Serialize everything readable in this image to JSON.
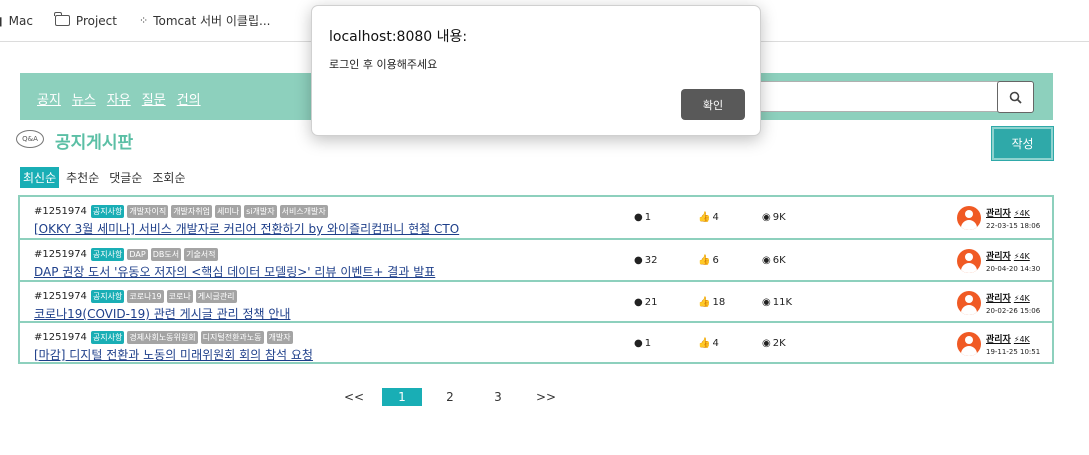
{
  "bookmarks": [
    {
      "label": "Mac",
      "icon": "apple-icon"
    },
    {
      "label": "Project",
      "icon": "folder-icon"
    },
    {
      "label": "Tomcat 서버 이클립...",
      "icon": "dots-icon"
    }
  ],
  "nav": {
    "links": [
      "공지",
      "뉴스",
      "자유",
      "질문",
      "건의"
    ],
    "search_icon": "search-icon"
  },
  "board": {
    "icon_text": "Q&A",
    "title": "공지게시판",
    "write_label": "작성"
  },
  "sort_tabs": [
    "최신순",
    "추천순",
    "댓글순",
    "조회순"
  ],
  "active_sort": "최신순",
  "posts": [
    {
      "id": "#1251974",
      "category": "공지사항",
      "tags": [
        "개발자이직",
        "개발자취업",
        "세미나",
        "si개발자",
        "서비스개발자"
      ],
      "title": "[OKKY 3월 세미나] 서비스 개발자로 커리어 전환하기 by 와이즐리컴퍼니 현철 CTO",
      "comments": "1",
      "likes": "4",
      "views": "9K",
      "author": "관리자",
      "points": "4K",
      "date": "22-03-15 18:06"
    },
    {
      "id": "#1251974",
      "category": "공지사항",
      "tags": [
        "DAP",
        "DB도서",
        "기술서적"
      ],
      "title": "DAP 권장 도서 '유동오 저자의 <핵심 데이터 모델링>' 리뷰 이벤트+ 결과 발표",
      "comments": "32",
      "likes": "6",
      "views": "6K",
      "author": "관리자",
      "points": "4K",
      "date": "20-04-20 14:30"
    },
    {
      "id": "#1251974",
      "category": "공지사항",
      "tags": [
        "코로나19",
        "코로나",
        "게시글관리"
      ],
      "title": "코로나19(COVID-19) 관련 게시글 관리 정책 안내",
      "comments": "21",
      "likes": "18",
      "views": "11K",
      "author": "관리자",
      "points": "4K",
      "date": "20-02-26 15:06"
    },
    {
      "id": "#1251974",
      "category": "공지사항",
      "tags": [
        "경제사회노동위원회",
        "디지털전환과노동",
        "개발자"
      ],
      "title": "[마감] 디지털 전환과 노동의 미래위원회 회의 참석 요청",
      "comments": "1",
      "likes": "4",
      "views": "2K",
      "author": "관리자",
      "points": "4K",
      "date": "19-11-25 10:51"
    }
  ],
  "pagination": {
    "prev": "<<",
    "pages": [
      "1",
      "2",
      "3"
    ],
    "current": "1",
    "next": ">>"
  },
  "dialog": {
    "title": "localhost:8080 내용:",
    "message": "로그인 후 이용해주세요",
    "confirm_label": "확인"
  },
  "colors": {
    "nav_bg": "#8dd0bd",
    "accent": "#19aeb5",
    "title": "#5bbfa5",
    "avatar": "#f05a24"
  }
}
